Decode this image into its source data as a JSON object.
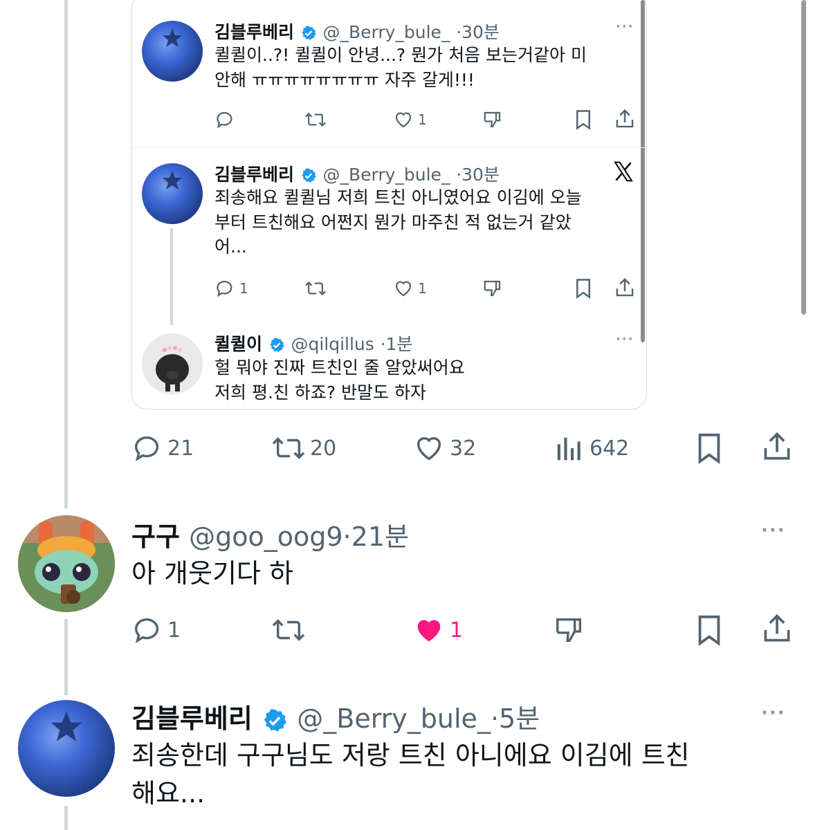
{
  "colors": {
    "text": "#0f1419",
    "meta": "#536471",
    "like_active": "#f91880",
    "verified": "#1d9bf0",
    "border": "#cfd9de"
  },
  "quoted": {
    "tweet1": {
      "name": "김블루베리",
      "handle": "@_Berry_bule_",
      "time": "30분",
      "text": "퀼퀼이..?! 퀼퀼이 안녕...? 뭔가 처음 보는거같아 미\n안해 ㅠㅠㅠㅠㅠㅠㅠㅠ 자주 갈게!!!",
      "likes": "1"
    },
    "tweet2": {
      "name": "김블루베리",
      "handle": "@_Berry_bule_",
      "time": "30분",
      "text": "죄송해요 퀼퀼님 저희 트친 아니였어요 이김에 오늘\n부터 트친해요 어쩐지 뭔가 마주친 적 없는거 같았\n어...",
      "replies": "1",
      "likes": "1"
    },
    "tweet3": {
      "name": "퀼퀼이",
      "handle": "@qilqillus",
      "time": "1분",
      "text": "헐 뭐야 진짜 트친인 줄 알았써어요\n저희 평.친 하죠? 반말도 하자"
    }
  },
  "main_actions": {
    "replies": "21",
    "retweets": "20",
    "likes": "32",
    "views": "642"
  },
  "reply1": {
    "name": "구구",
    "handle": "@goo_oog9",
    "time": "21분",
    "text": "아 개웃기다 하",
    "replies": "1",
    "likes": "1"
  },
  "reply2": {
    "name": "김블루베리",
    "handle": "@_Berry_bule_",
    "time": "5분",
    "text": "죄송한데 구구님도 저랑 트친 아니에요 이김에 트친\n해요..."
  },
  "icons": {
    "reply": "reply-icon",
    "retweet": "retweet-icon",
    "like": "heart-icon",
    "dislike": "downvote-icon",
    "bookmark": "bookmark-icon",
    "share": "share-icon",
    "views": "views-icon",
    "more": "more-icon",
    "x_logo": "x-logo-icon",
    "verified": "verified-icon"
  }
}
